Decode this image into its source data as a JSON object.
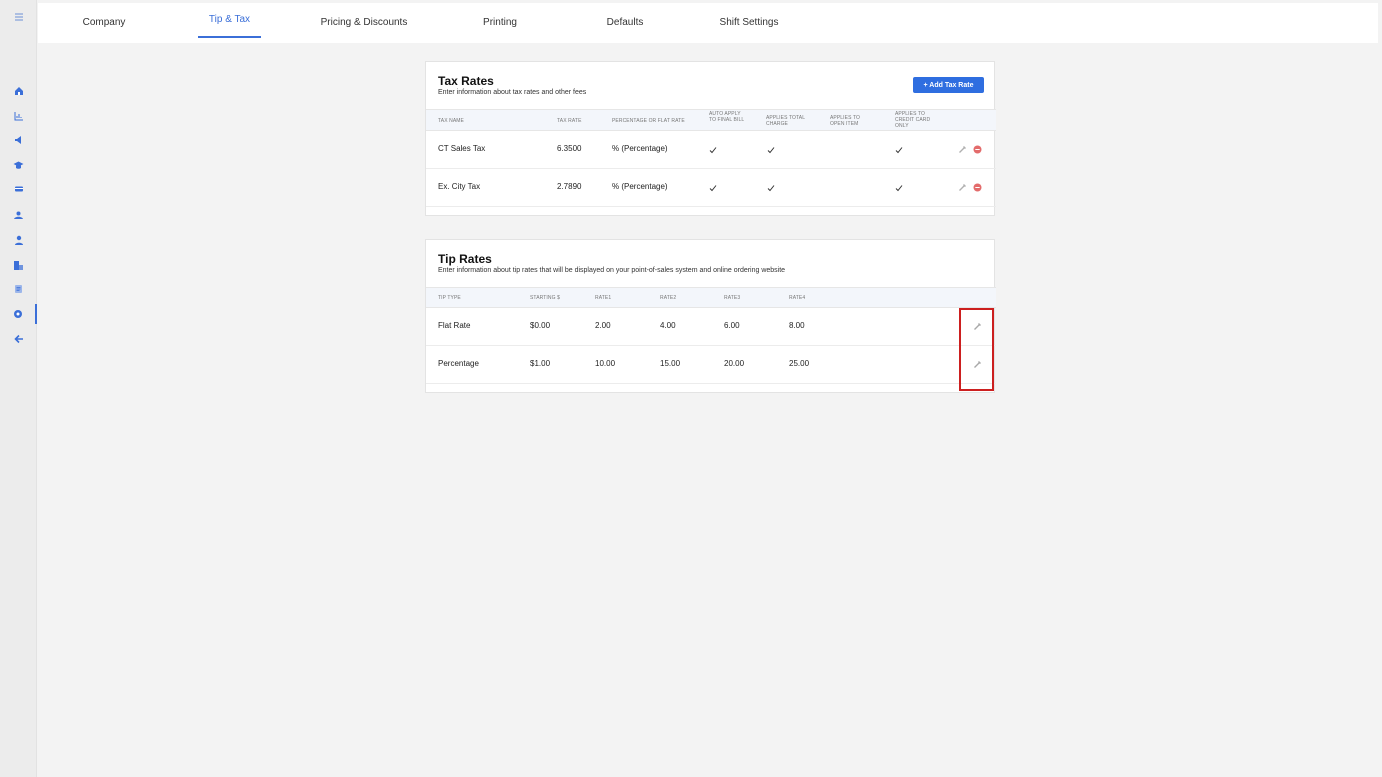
{
  "sidebar": {
    "icons": [
      "menu-icon",
      "home-icon",
      "chart-icon",
      "megaphone-icon",
      "graduation-cap-icon",
      "card-icon",
      "user-group-icon",
      "person-icon",
      "buildings-icon",
      "document-icon",
      "gear-icon",
      "arrow-left-icon"
    ],
    "active": "gear-icon"
  },
  "tabs": [
    {
      "label": "Company",
      "active": false
    },
    {
      "label": "Tip & Tax",
      "active": true
    },
    {
      "label": "Pricing & Discounts",
      "active": false
    },
    {
      "label": "Printing",
      "active": false
    },
    {
      "label": "Defaults",
      "active": false
    },
    {
      "label": "Shift Settings",
      "active": false
    }
  ],
  "tax_rates": {
    "title": "Tax Rates",
    "subtitle": "Enter information about tax rates and other fees",
    "add_button": "+ Add Tax Rate",
    "columns": [
      "TAX NAME",
      "TAX RATE",
      "PERCENTAGE OR FLAT RATE",
      "AUTO APPLY TO FINAL BILL",
      "APPLIES TOTAL CHARGE",
      "APPLIES TO OPEN ITEM",
      "APPLIES TO CREDIT CARD ONLY"
    ],
    "rows": [
      {
        "name": "CT Sales Tax",
        "rate": "6.3500",
        "type": "% (Percentage)",
        "auto_apply": true,
        "applies_total": true,
        "applies_open": false,
        "credit_card_only": true
      },
      {
        "name": "Ex. City Tax",
        "rate": "2.7890",
        "type": "% (Percentage)",
        "auto_apply": true,
        "applies_total": true,
        "applies_open": false,
        "credit_card_only": true
      }
    ]
  },
  "tip_rates": {
    "title": "Tip Rates",
    "subtitle": "Enter information about tip rates that will be displayed on your point-of-sales system and online ordering website",
    "columns": [
      "TIP TYPE",
      "STARTING $",
      "RATE1",
      "RATE2",
      "RATE3",
      "RATE4"
    ],
    "rows": [
      {
        "type": "Flat Rate",
        "starting": "$0.00",
        "rate1": "2.00",
        "rate2": "4.00",
        "rate3": "6.00",
        "rate4": "8.00"
      },
      {
        "type": "Percentage",
        "starting": "$1.00",
        "rate1": "10.00",
        "rate2": "15.00",
        "rate3": "20.00",
        "rate4": "25.00"
      }
    ]
  },
  "colors": {
    "accent": "#2f6ee0",
    "highlight": "#cc1f1f",
    "delete": "#e36b6b"
  }
}
